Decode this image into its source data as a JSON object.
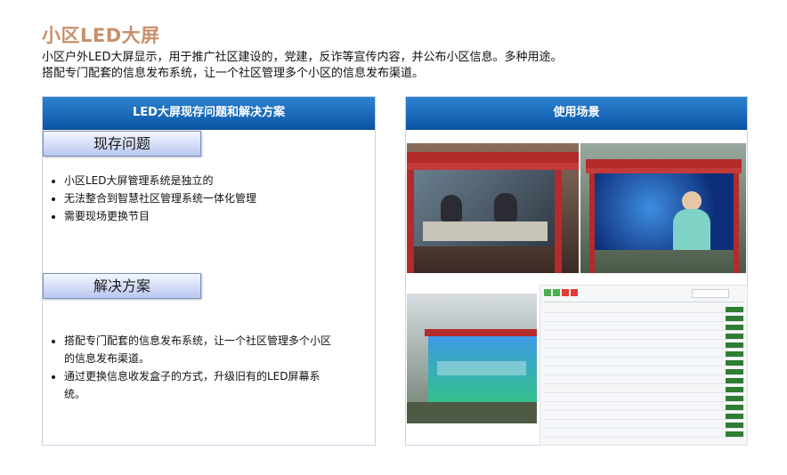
{
  "header": {
    "title": "小区LED大屏",
    "intro_line1": "小区户外LED大屏显示，用于推广社区建设的，党建，反诈等宣传内容，并公布小区信息。多种用途。",
    "intro_line2": "搭配专门配套的信息发布系统，让一个社区管理多个小区的信息发布渠道。"
  },
  "left_panel": {
    "header": "LED大屏现存问题和解决方案",
    "problems_tab": "现存问题",
    "problems": [
      "小区LED大屏管理系统是独立的",
      "无法整合到智慧社区管理系统一体化管理",
      "需要现场更换节目"
    ],
    "solutions_tab": "解决方案",
    "solutions": [
      "搭配专门配套的信息发布系统，让一个社区管理多个小区的信息发布渠道。",
      "通过更换信息收发盒子的方式，升级旧有的LED屏幕系统。"
    ]
  },
  "right_panel": {
    "header": "使用场景"
  },
  "colors": {
    "title": "#c8906a",
    "header_blue": "#0d55a6",
    "frame_red": "#b32b2b"
  }
}
